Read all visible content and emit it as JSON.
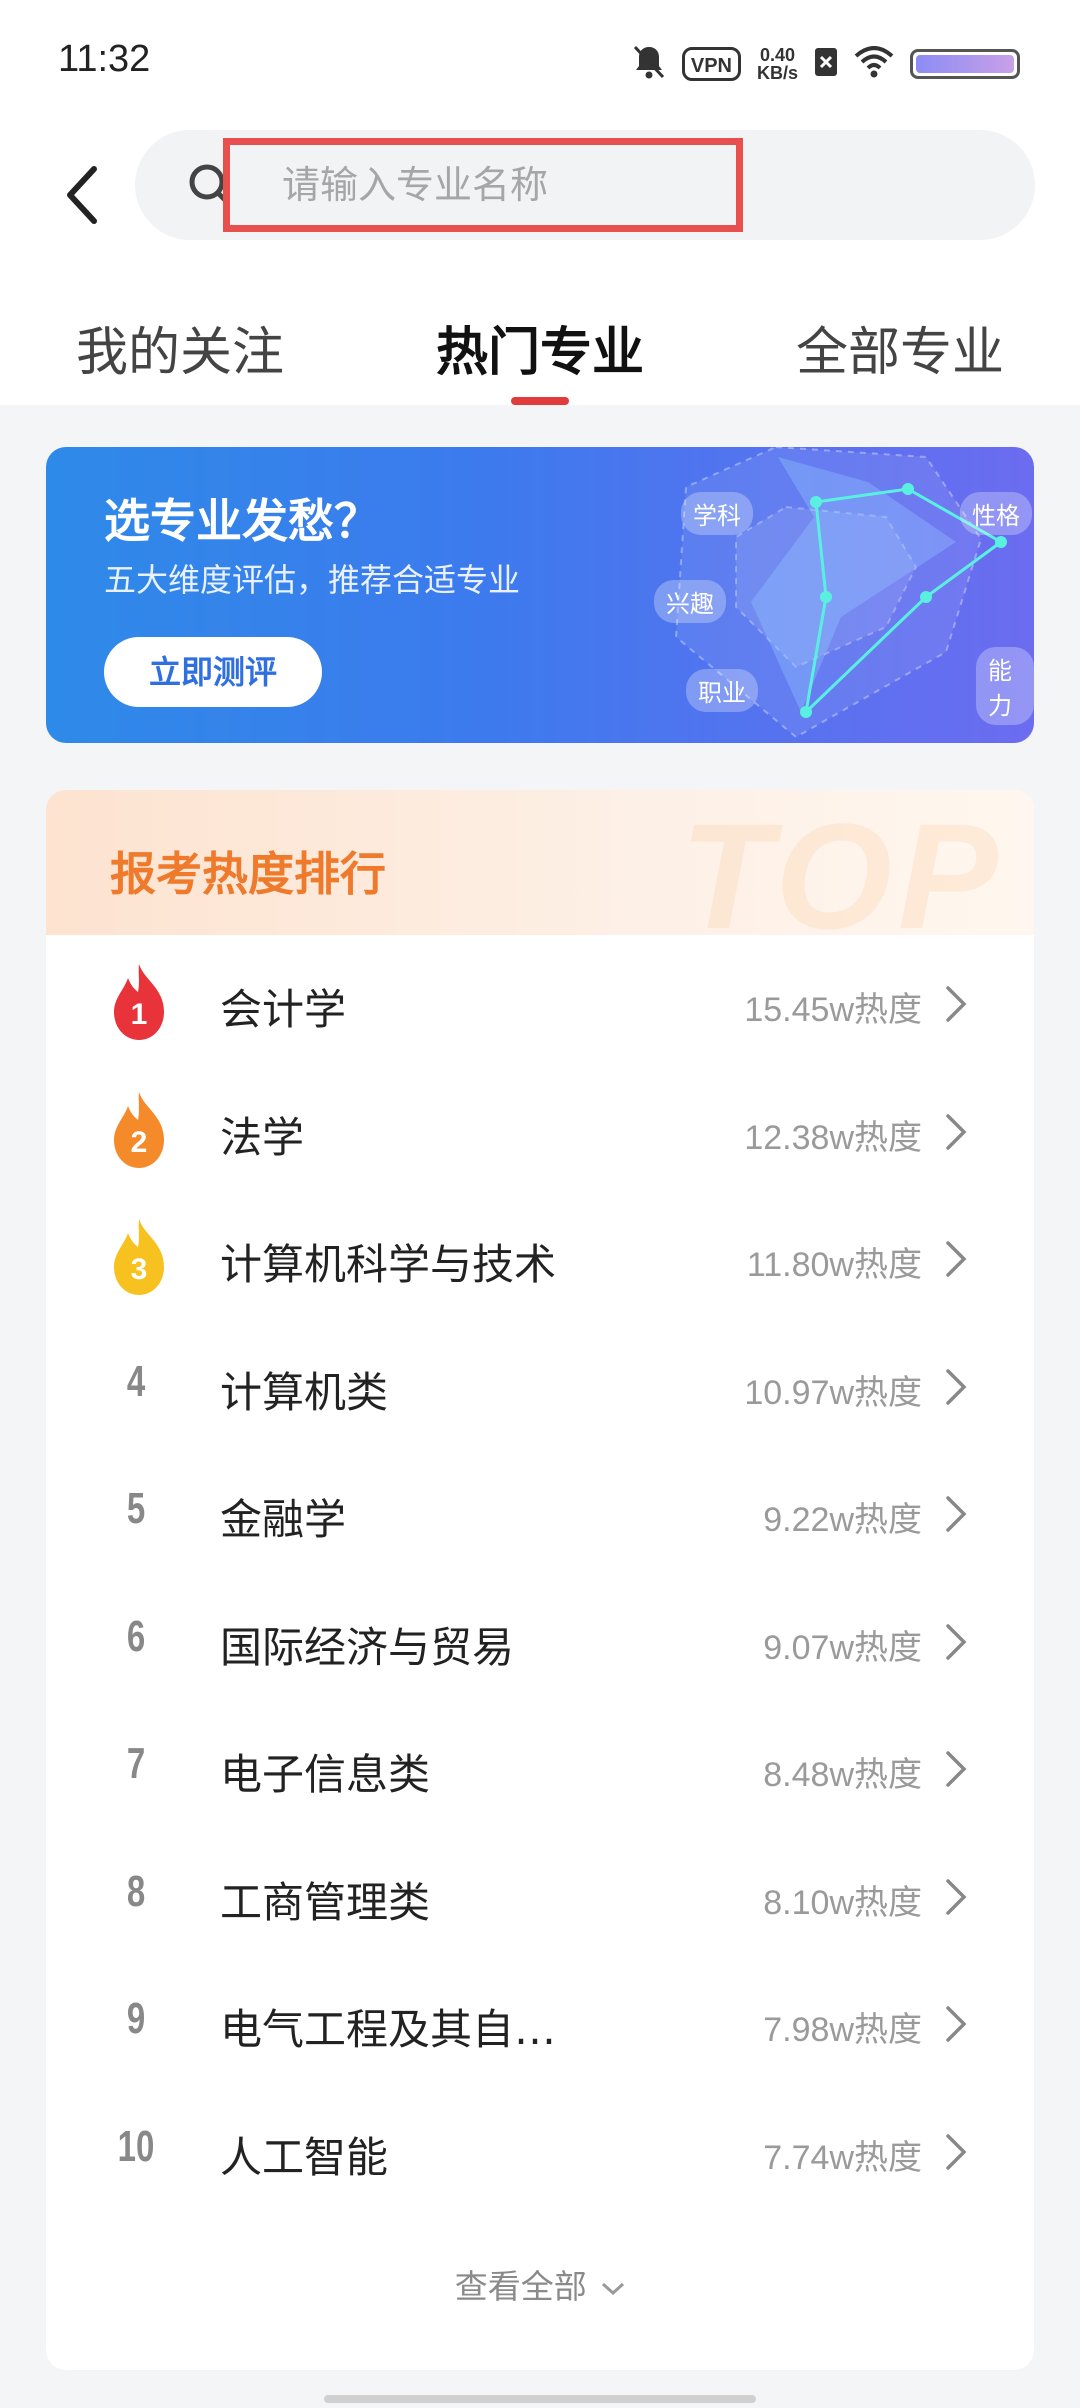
{
  "status_bar": {
    "time": "11:32",
    "vpn": "VPN",
    "speed_value": "0.40",
    "speed_unit": "KB/s"
  },
  "search": {
    "placeholder": "请输入专业名称"
  },
  "tabs": [
    {
      "label": "我的关注",
      "active": false
    },
    {
      "label": "热门专业",
      "active": true
    },
    {
      "label": "全部专业",
      "active": false
    }
  ],
  "banner": {
    "title": "选专业发愁？",
    "subtitle": "五大维度评估，推荐合适专业",
    "button": "立即测评",
    "radar_tags": [
      "学科",
      "性格",
      "兴趣",
      "能力",
      "职业"
    ]
  },
  "ranking": {
    "title": "报考热度排行",
    "watermark": "TOP",
    "heat_suffix": "热度",
    "items": [
      {
        "rank": "1",
        "name": "会计学",
        "heat": "15.45w"
      },
      {
        "rank": "2",
        "name": "法学",
        "heat": "12.38w"
      },
      {
        "rank": "3",
        "name": "计算机科学与技术",
        "heat": "11.80w"
      },
      {
        "rank": "4",
        "name": "计算机类",
        "heat": "10.97w"
      },
      {
        "rank": "5",
        "name": "金融学",
        "heat": "9.22w"
      },
      {
        "rank": "6",
        "name": "国际经济与贸易",
        "heat": "9.07w"
      },
      {
        "rank": "7",
        "name": "电子信息类",
        "heat": "8.48w"
      },
      {
        "rank": "8",
        "name": "工商管理类",
        "heat": "8.10w"
      },
      {
        "rank": "9",
        "name": "电气工程及其自…",
        "heat": "7.98w"
      },
      {
        "rank": "10",
        "name": "人工智能",
        "heat": "7.74w"
      }
    ],
    "view_all": "查看全部"
  },
  "colors": {
    "accent_red": "#e23b3b",
    "rank_title_orange": "#ef7a2c",
    "flame_1": "#e8333a",
    "flame_2": "#f58a2a",
    "flame_3": "#f7c21f"
  }
}
